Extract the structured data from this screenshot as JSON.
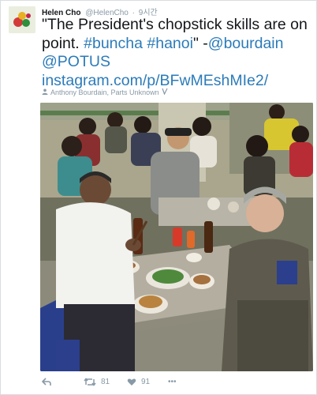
{
  "tweet": {
    "author_name": "Helen Cho",
    "author_handle": "@HelenCho",
    "separator": "·",
    "timestamp": "9시간",
    "text_quote": "\"The President's chopstick skills are on point. ",
    "hashtag_buncha": "#buncha",
    "hashtag_hanoi": "#hanoi",
    "text_mid": "\" -",
    "mention_bourdain": "@bourdain",
    "mention_potus": "@POTUS",
    "link_instagram": "instagram.com/p/BFwMEshMIe2/",
    "attribution": "Anthony Bourdain, Parts Unknown",
    "attribution_icons": [
      "person-icon",
      "vine-icon"
    ]
  },
  "actions": {
    "reply_icon": "reply-icon",
    "retweet_icon": "retweet-icon",
    "retweet_count": "81",
    "like_icon": "heart-icon",
    "like_count": "91",
    "more_label": "•••"
  },
  "colors": {
    "link": "#2b7bb9",
    "muted": "#8899a6",
    "text": "#14171a",
    "border": "#d9dde1"
  }
}
